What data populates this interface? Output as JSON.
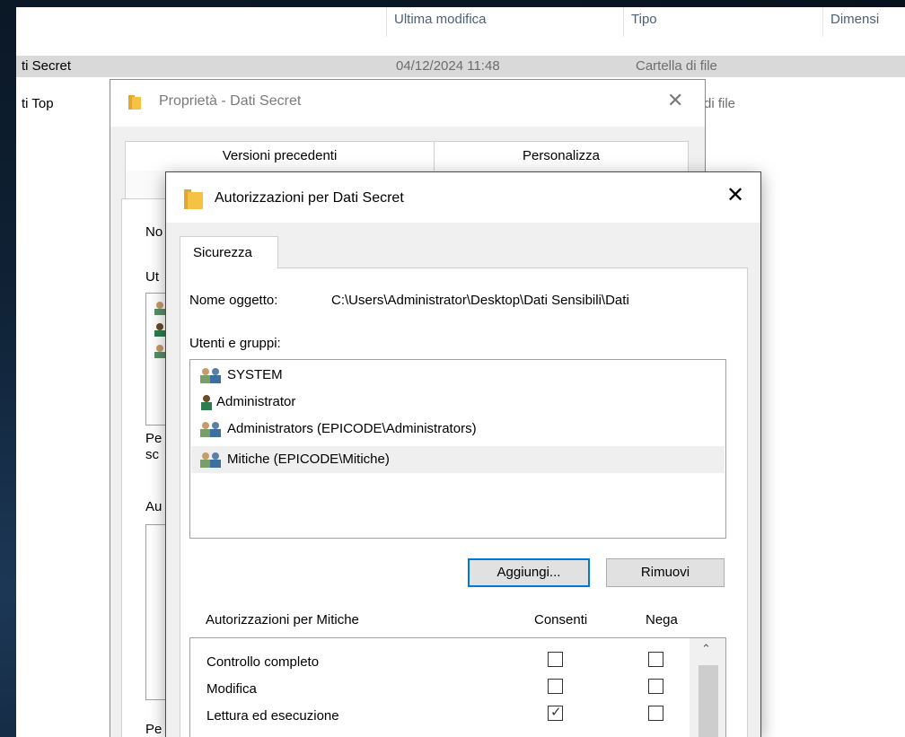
{
  "explorer": {
    "columns": {
      "modified": "Ultima modifica",
      "type": "Tipo",
      "size": "Dimensi"
    },
    "rows": [
      {
        "name": "ti Secret",
        "modified": "04/12/2024 11:48",
        "type": "Cartella di file",
        "selected": true
      },
      {
        "name": "ti Top",
        "type": "di file"
      }
    ]
  },
  "properties_dialog": {
    "title": "Proprietà - Dati Secret",
    "tabs": [
      "Versioni precedenti",
      "Personalizza"
    ],
    "peek": [
      "No",
      "Ut",
      "Pe",
      "sc",
      "Au",
      "Pe"
    ]
  },
  "permissions_dialog": {
    "title": "Autorizzazioni per Dati Secret",
    "tab": "Sicurezza",
    "object_label": "Nome oggetto:",
    "object_value": "C:\\Users\\Administrator\\Desktop\\Dati Sensibili\\Dati",
    "users_label": "Utenti e gruppi:",
    "users": [
      {
        "name": "SYSTEM",
        "icon": "group-icon"
      },
      {
        "name": "Administrator",
        "icon": "user-icon"
      },
      {
        "name": "Administrators (EPICODE\\Administrators)",
        "icon": "group-icon"
      },
      {
        "name": "Mitiche (EPICODE\\Mitiche)",
        "icon": "group-icon",
        "selected": true
      }
    ],
    "add_button": "Aggiungi...",
    "remove_button": "Rimuovi",
    "permissions_for": "Autorizzazioni per Mitiche",
    "allow_header": "Consenti",
    "deny_header": "Nega",
    "permissions": [
      {
        "name": "Controllo completo",
        "allow": false,
        "deny": false
      },
      {
        "name": "Modifica",
        "allow": false,
        "deny": false
      },
      {
        "name": "Lettura ed esecuzione",
        "allow": true,
        "deny": false
      }
    ],
    "checkmark": "✓",
    "close_glyph": "✕",
    "scroll_up_glyph": "⌃"
  },
  "colors": {
    "accent": "#0078d7",
    "folder": "#f6c244",
    "selected_row": "#d9d9d9"
  }
}
